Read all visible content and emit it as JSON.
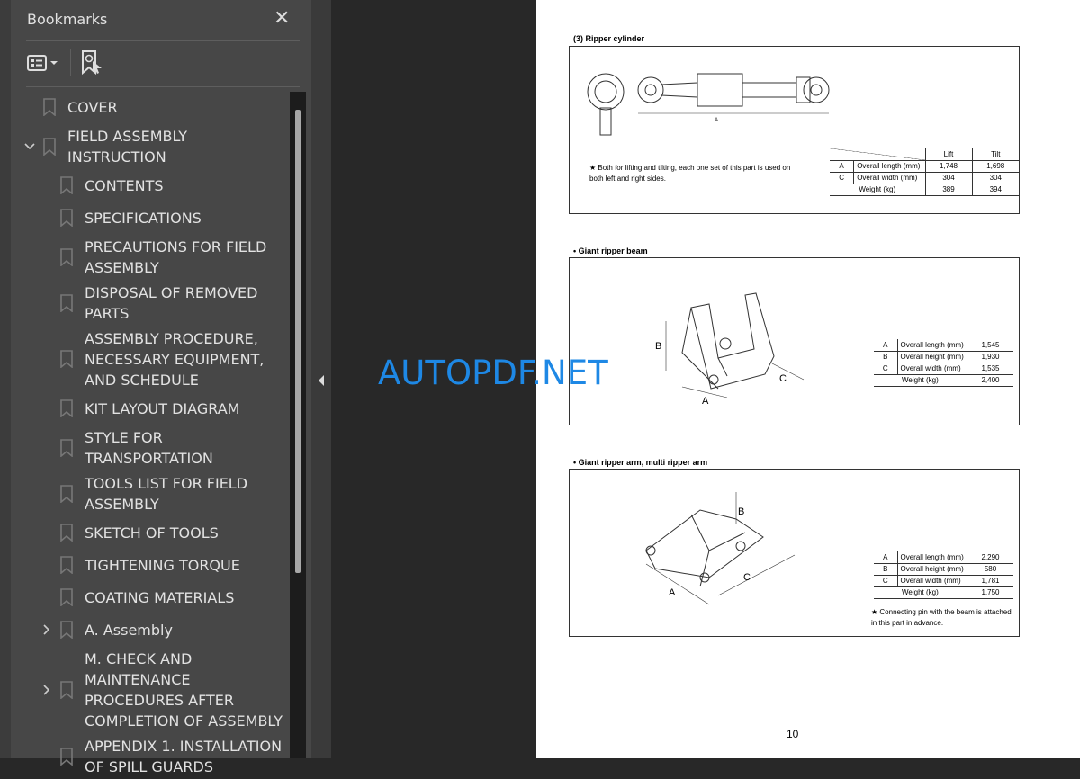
{
  "sidebar": {
    "title": "Bookmarks",
    "close_icon": "close-icon",
    "options_icon": "list-options-icon",
    "find_icon": "find-current-bookmark-icon",
    "items": [
      {
        "label": "COVER",
        "level": 0,
        "expander": "none"
      },
      {
        "label": "FIELD ASSEMBLY INSTRUCTION",
        "level": 0,
        "expander": "expanded"
      },
      {
        "label": "CONTENTS",
        "level": 1,
        "expander": "none"
      },
      {
        "label": "SPECIFICATIONS",
        "level": 1,
        "expander": "none"
      },
      {
        "label": "PRECAUTIONS FOR FIELD ASSEMBLY",
        "level": 1,
        "expander": "none"
      },
      {
        "label": "DISPOSAL OF REMOVED PARTS",
        "level": 1,
        "expander": "none"
      },
      {
        "label": "ASSEMBLY PROCEDURE, NECESSARY EQUIPMENT, AND SCHEDULE",
        "level": 1,
        "expander": "none"
      },
      {
        "label": "KIT LAYOUT DIAGRAM",
        "level": 1,
        "expander": "none"
      },
      {
        "label": "STYLE FOR TRANSPORTATION",
        "level": 1,
        "expander": "none"
      },
      {
        "label": "TOOLS LIST FOR FIELD ASSEMBLY",
        "level": 1,
        "expander": "none"
      },
      {
        "label": "SKETCH OF TOOLS",
        "level": 1,
        "expander": "none"
      },
      {
        "label": "TIGHTENING TORQUE",
        "level": 1,
        "expander": "none"
      },
      {
        "label": "COATING MATERIALS",
        "level": 1,
        "expander": "none"
      },
      {
        "label": "A. Assembly",
        "level": 1,
        "expander": "collapsed"
      },
      {
        "label": "M. CHECK AND MAINTENANCE PROCEDURES AFTER COMPLETION OF ASSEMBLY",
        "level": 1,
        "expander": "collapsed"
      },
      {
        "label": "APPENDIX 1. INSTALLATION OF SPILL GUARDS",
        "level": 1,
        "expander": "none"
      }
    ]
  },
  "document": {
    "watermark": "AUTOPDF.NET",
    "page_number": "10",
    "sections": [
      {
        "title": "(3) Ripper cylinder",
        "dim_label": "A",
        "note": "★  Both for lifting and tilting, each one set of this part is used on both left and right sides.",
        "columns": [
          "Lift",
          "Tilt"
        ],
        "rows": [
          [
            "A",
            "Overall length (mm)",
            "1,748",
            "1,698"
          ],
          [
            "C",
            "Overall width (mm)",
            "304",
            "304"
          ],
          [
            "",
            "Weight (kg)",
            "389",
            "394"
          ]
        ]
      },
      {
        "title": "• Giant ripper beam",
        "dim_labels": [
          "A",
          "B",
          "C"
        ],
        "rows": [
          [
            "A",
            "Overall length (mm)",
            "1,545"
          ],
          [
            "B",
            "Overall height (mm)",
            "1,930"
          ],
          [
            "C",
            "Overall width (mm)",
            "1,535"
          ],
          [
            "",
            "Weight (kg)",
            "2,400"
          ]
        ]
      },
      {
        "title": "• Giant ripper arm, multi ripper arm",
        "dim_labels": [
          "A",
          "B",
          "C"
        ],
        "note": "★  Connecting pin with the beam is attached in this part in advance.",
        "rows": [
          [
            "A",
            "Overall length (mm)",
            "2,290"
          ],
          [
            "B",
            "Overall height (mm)",
            "580"
          ],
          [
            "C",
            "Overall width (mm)",
            "1,781"
          ],
          [
            "",
            "Weight (kg)",
            "1,750"
          ]
        ]
      }
    ]
  }
}
